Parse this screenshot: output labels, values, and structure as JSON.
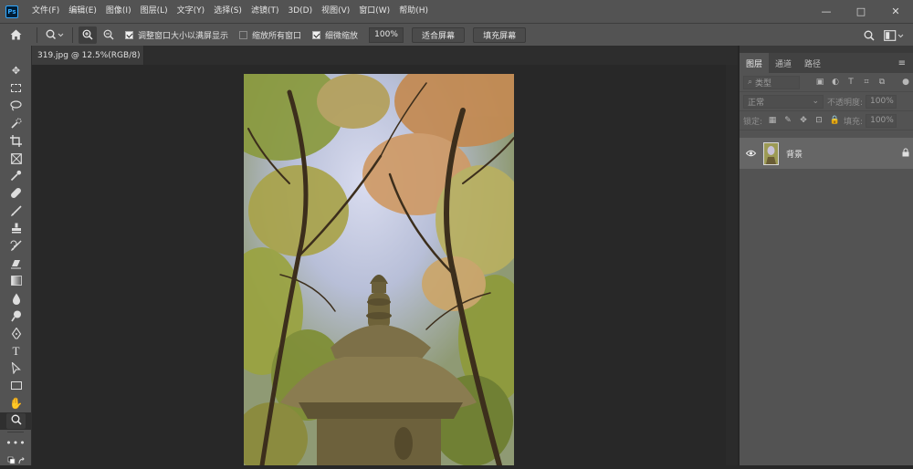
{
  "app": {
    "logo": "Ps"
  },
  "menu": [
    "文件(F)",
    "编辑(E)",
    "图像(I)",
    "图层(L)",
    "文字(Y)",
    "选择(S)",
    "滤镜(T)",
    "3D(D)",
    "视图(V)",
    "窗口(W)",
    "帮助(H)"
  ],
  "window_controls": {
    "minimize": "—",
    "maximize": "□",
    "close": "✕"
  },
  "options": {
    "resize_windows_label": "调整窗口大小以满屏显示",
    "resize_windows_checked": true,
    "zoom_all_label": "缩放所有窗口",
    "zoom_all_checked": false,
    "scrubby_zoom_label": "细微缩放",
    "scrubby_zoom_checked": true,
    "zoom_value": "100%",
    "fit_screen_label": "适合屏幕",
    "fill_screen_label": "填充屏幕"
  },
  "document": {
    "tab_title": "319.jpg @ 12.5%(RGB/8)",
    "close": "×"
  },
  "panel": {
    "tabs": [
      "图层",
      "通道",
      "路径"
    ],
    "active_tab": "图层",
    "kind_placeholder": "类型",
    "blend_mode": "正常",
    "opacity_label": "不透明度:",
    "opacity_value": "100%",
    "lock_label": "锁定:",
    "fill_label": "填充:",
    "fill_value": "100%",
    "layers": [
      {
        "name": "背景",
        "visible": true,
        "locked": true
      }
    ]
  },
  "colors": {
    "chrome": "#535353",
    "workspace": "#282828",
    "panel_selected_row": "#666666",
    "ps_blue": "#31a8ff"
  }
}
